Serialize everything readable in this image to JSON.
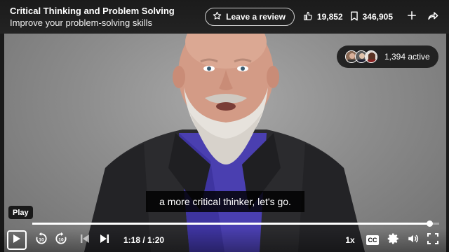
{
  "header": {
    "title": "Critical Thinking and Problem Solving",
    "subtitle": "Improve your problem-solving skills",
    "review_label": "Leave a review",
    "likes": "19,852",
    "saves": "346,905"
  },
  "viewers": {
    "active_label": "1,394 active"
  },
  "video": {
    "caption": "a more critical thinker, let's go.",
    "tooltip": "Play",
    "time": "1:18 / 1:20",
    "progress": 0.975,
    "speed": "1x",
    "cc_label": "CC"
  },
  "colors": {
    "header_bg": "#1b1b1b",
    "shirt": "#4a3fb0",
    "jacket": "#2a2a2c"
  }
}
